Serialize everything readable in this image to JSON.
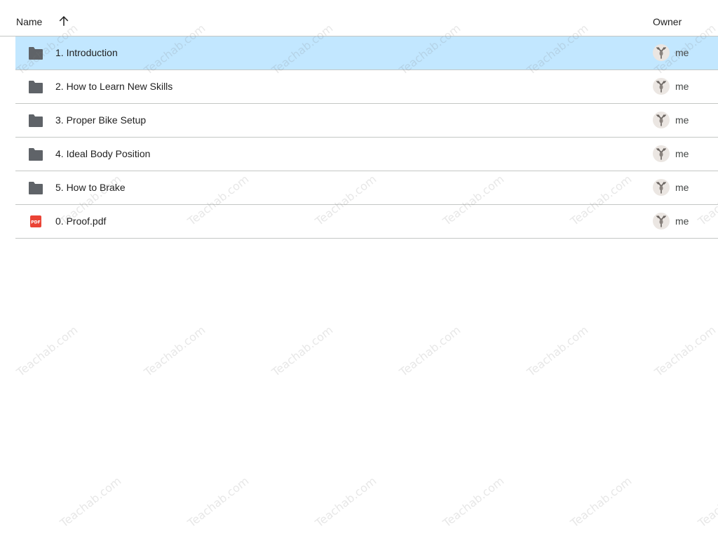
{
  "header": {
    "name_label": "Name",
    "owner_label": "Owner",
    "sort_icon": "arrow-up-icon"
  },
  "files": [
    {
      "type": "folder",
      "icon": "folder-icon",
      "name": "1. Introduction",
      "owner": "me",
      "selected": true
    },
    {
      "type": "folder",
      "icon": "folder-icon",
      "name": "2. How to Learn New Skills",
      "owner": "me",
      "selected": false
    },
    {
      "type": "folder",
      "icon": "folder-icon",
      "name": "3. Proper Bike Setup",
      "owner": "me",
      "selected": false
    },
    {
      "type": "folder",
      "icon": "folder-icon",
      "name": "4. Ideal Body Position",
      "owner": "me",
      "selected": false
    },
    {
      "type": "folder",
      "icon": "folder-icon",
      "name": "5. How to Brake",
      "owner": "me",
      "selected": false
    },
    {
      "type": "pdf",
      "icon": "pdf-icon",
      "name": "0. Proof.pdf",
      "owner": "me",
      "selected": false
    }
  ],
  "colors": {
    "selected_row": "#c2e7ff",
    "folder": "#5f6368",
    "pdf": "#ea4335",
    "divider": "#c4c7c5"
  },
  "watermark": {
    "text": "Teachab.com"
  }
}
